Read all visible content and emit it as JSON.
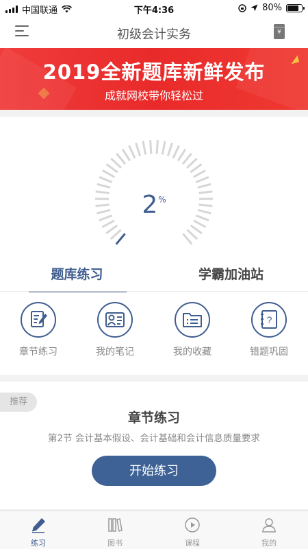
{
  "status_bar": {
    "carrier": "中国联通",
    "time": "下午4:36",
    "battery": "80%",
    "battery_level": 0.8
  },
  "nav": {
    "title": "初级会计实务",
    "menu_icon": "hamburger-menu-icon",
    "wallet_icon": "yen-wallet-icon",
    "wallet_glyph": "¥"
  },
  "banner": {
    "headline": "2019全新题库新鲜发布",
    "subtitle": "成就网校带你轻松过"
  },
  "progress": {
    "value": "2",
    "unit": "%",
    "fraction": 0.02
  },
  "tabs": [
    {
      "label": "题库练习",
      "active": true
    },
    {
      "label": "学霸加油站",
      "active": false
    }
  ],
  "quick_actions": [
    {
      "label": "章节练习",
      "icon": "edit-document-icon"
    },
    {
      "label": "我的笔记",
      "icon": "profile-card-icon"
    },
    {
      "label": "我的收藏",
      "icon": "folder-list-icon"
    },
    {
      "label": "错题巩固",
      "icon": "question-notebook-icon"
    }
  ],
  "recommend": {
    "badge": "推荐",
    "title": "章节练习",
    "description": "第2节 会计基本假设、会计基础和会计信息质量要求",
    "button": "开始练习"
  },
  "tab_bar": [
    {
      "label": "练习",
      "icon": "pencil-icon",
      "active": true
    },
    {
      "label": "图书",
      "icon": "books-icon",
      "active": false
    },
    {
      "label": "课程",
      "icon": "play-circle-icon",
      "active": false
    },
    {
      "label": "我的",
      "icon": "user-icon",
      "active": false
    }
  ],
  "colors": {
    "primary": "#3f5d8f",
    "banner_red": "#e92a2a",
    "button": "#3e6296"
  }
}
